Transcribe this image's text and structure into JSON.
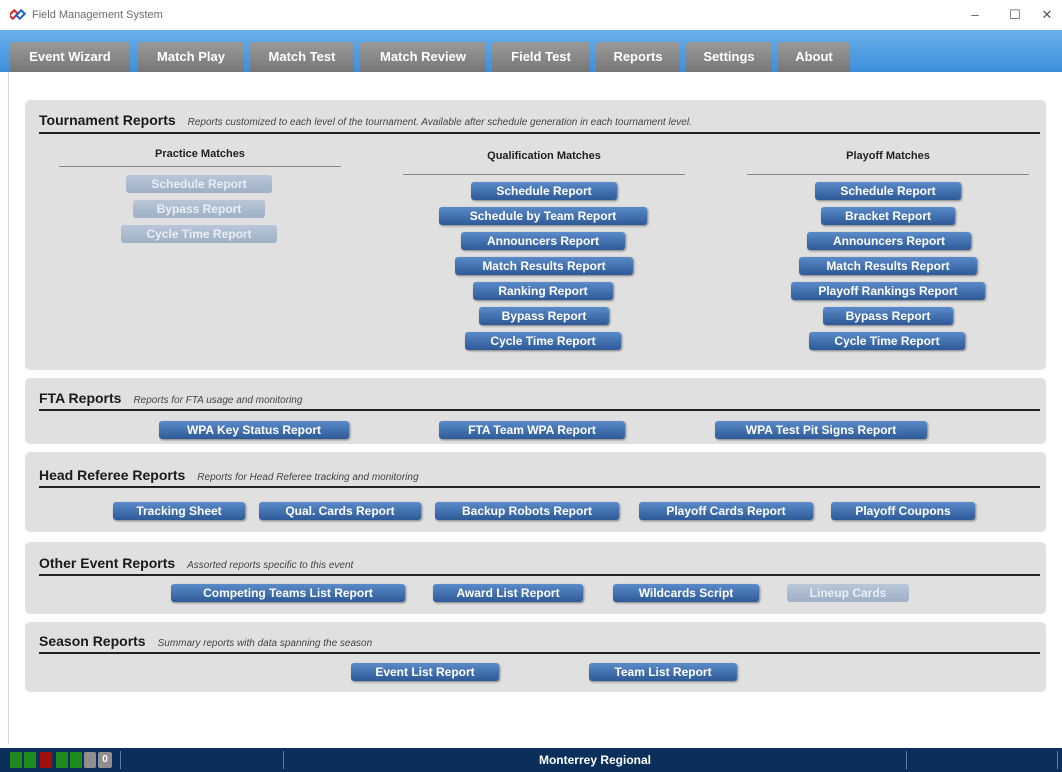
{
  "window": {
    "title": "Field Management System",
    "minimize": "–",
    "maximize": "☐",
    "close": "✕"
  },
  "tabs": [
    "Event Wizard",
    "Match Play",
    "Match Test",
    "Match Review",
    "Field Test",
    "Reports",
    "Settings",
    "About"
  ],
  "tournament": {
    "title": "Tournament Reports",
    "subtitle": "Reports customized to each level of the tournament. Available after schedule generation in each tournament level.",
    "practice": {
      "header": "Practice Matches",
      "buttons": [
        "Schedule Report",
        "Bypass Report",
        "Cycle Time Report"
      ]
    },
    "qualification": {
      "header": "Qualification Matches",
      "buttons": [
        "Schedule Report",
        "Schedule by Team Report",
        "Announcers Report",
        "Match Results Report",
        "Ranking Report",
        "Bypass Report",
        "Cycle Time Report"
      ]
    },
    "playoff": {
      "header": "Playoff Matches",
      "buttons": [
        "Schedule Report",
        "Bracket Report",
        "Announcers Report",
        "Match Results Report",
        "Playoff Rankings Report",
        "Bypass Report",
        "Cycle Time Report"
      ]
    }
  },
  "fta": {
    "title": "FTA Reports",
    "subtitle": "Reports for FTA usage and monitoring",
    "buttons": [
      "WPA Key Status Report",
      "FTA Team WPA Report",
      "WPA Test Pit Signs Report"
    ]
  },
  "referee": {
    "title": "Head Referee Reports",
    "subtitle": "Reports for Head Referee tracking and monitoring",
    "buttons": [
      "Tracking Sheet",
      "Qual. Cards Report",
      "Backup Robots Report",
      "Playoff Cards Report",
      "Playoff Coupons"
    ]
  },
  "other": {
    "title": "Other Event Reports",
    "subtitle": "Assorted reports specific to this event",
    "buttons": [
      "Competing Teams List Report",
      "Award List Report",
      "Wildcards Script",
      "Lineup Cards"
    ]
  },
  "season": {
    "title": "Season Reports",
    "subtitle": "Summary reports with data spanning the season",
    "buttons": [
      "Event List Report",
      "Team List Report"
    ]
  },
  "status": {
    "count": "0",
    "event_name": "Monterrey Regional",
    "colors": {
      "green": "#1f8a1f",
      "red": "#a01010",
      "gray": "#8f8f8f"
    }
  }
}
